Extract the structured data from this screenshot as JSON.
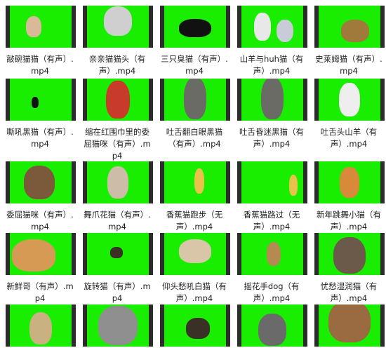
{
  "accent_colors": {
    "green_screen": "#19ee00",
    "film_border": "#2c2c2c",
    "text": "#222222"
  },
  "files": [
    {
      "name": "敲碗猫猫（有声）.mp4",
      "icon": "cat-thumbnail-icon"
    },
    {
      "name": "亲亲猫猫头（有声）.mp4",
      "icon": "cat-thumbnail-icon"
    },
    {
      "name": "三只臭猫（有声）.mp4",
      "icon": "cat-thumbnail-icon"
    },
    {
      "name": "山羊与huh猫（有声）.mp4",
      "icon": "cat-thumbnail-icon"
    },
    {
      "name": "史莱姆猫（有声）.mp4",
      "icon": "cat-thumbnail-icon"
    },
    {
      "name": "嘶吼黑猫（有声）.mp4",
      "icon": "cat-thumbnail-icon"
    },
    {
      "name": "缩在红围巾里的委屈猫咪（有声）.mp4",
      "icon": "cat-thumbnail-icon"
    },
    {
      "name": "吐舌翻白眼黑猫（有声）.mp4",
      "icon": "cat-thumbnail-icon"
    },
    {
      "name": "吐舌昏迷黑猫（有声）.mp4",
      "icon": "cat-thumbnail-icon"
    },
    {
      "name": "吐舌头山羊（有声）.mp4",
      "icon": "goat-thumbnail-icon"
    },
    {
      "name": "委屈猫咪（有声）.mp4",
      "icon": "cat-thumbnail-icon"
    },
    {
      "name": "舞爪花猫（有声）.mp4",
      "icon": "cat-thumbnail-icon"
    },
    {
      "name": "香蕉猫跑步（无声）.mp4",
      "icon": "banana-cat-thumbnail-icon"
    },
    {
      "name": "香蕉猫路过（无声）.mp4",
      "icon": "banana-cat-thumbnail-icon"
    },
    {
      "name": "新年跳舞小猫（有声）.mp4",
      "icon": "cat-thumbnail-icon"
    },
    {
      "name": "新鲜哥（有声）.mp4",
      "icon": "cat-thumbnail-icon"
    },
    {
      "name": "旋转猫（有声）.mp4",
      "icon": "cat-thumbnail-icon"
    },
    {
      "name": "仰头愁吼白猫（有声）.mp4",
      "icon": "cat-thumbnail-icon"
    },
    {
      "name": "摇花手dog（有声）.mp4",
      "icon": "dog-thumbnail-icon"
    },
    {
      "name": "忧愁湿润猫（有声）.mp4",
      "icon": "cat-thumbnail-icon"
    },
    {
      "name": "",
      "icon": "cat-thumbnail-icon"
    },
    {
      "name": "",
      "icon": "dog-thumbnail-icon"
    },
    {
      "name": "",
      "icon": "cat-thumbnail-icon"
    },
    {
      "name": "",
      "icon": "cat-thumbnail-icon"
    },
    {
      "name": "",
      "icon": "cat-thumbnail-icon"
    }
  ]
}
